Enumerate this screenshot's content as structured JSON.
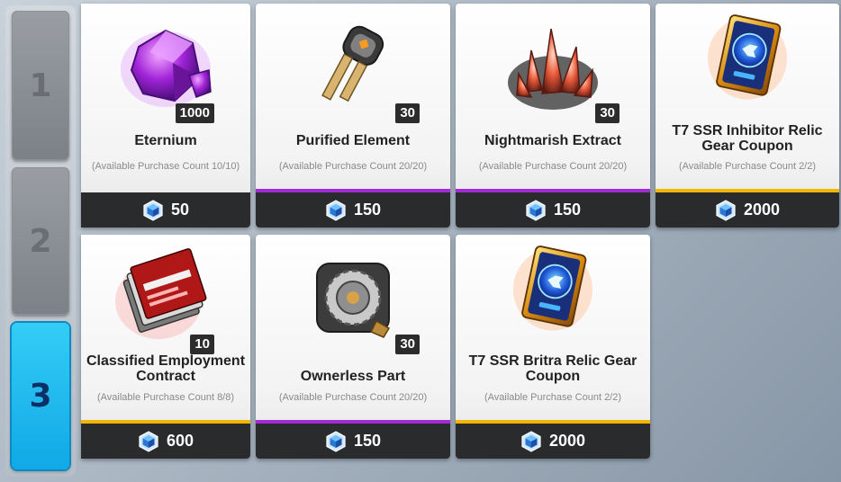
{
  "tabs": [
    {
      "label": "1",
      "active": false
    },
    {
      "label": "2",
      "active": false
    },
    {
      "label": "3",
      "active": true
    }
  ],
  "currency_icon": "gem-icon",
  "rarity_colors": {
    "purple": "#a12bd4",
    "gold": "#f2b705"
  },
  "items": [
    {
      "name": "Eternium",
      "quantity": "1000",
      "availability": "(Available Purchase Count 10/10)",
      "price": "50",
      "rarity": "none",
      "icon": "purple-crystal-icon"
    },
    {
      "name": "Purified Element",
      "quantity": "30",
      "availability": "(Available Purchase Count 20/20)",
      "price": "150",
      "rarity": "purple",
      "icon": "key-element-icon"
    },
    {
      "name": "Nightmarish Extract",
      "quantity": "30",
      "availability": "(Available Purchase Count 20/20)",
      "price": "150",
      "rarity": "purple",
      "icon": "red-crystal-cluster-icon"
    },
    {
      "name": "T7 SSR Inhibitor Relic Gear Coupon",
      "quantity": "",
      "availability": "(Available Purchase Count 2/2)",
      "price": "2000",
      "rarity": "gold",
      "icon": "gold-coupon-card-icon"
    },
    {
      "name": "Classified Employment Contract",
      "quantity": "10",
      "availability": "(Available Purchase Count 8/8)",
      "price": "600",
      "rarity": "gold",
      "icon": "contract-documents-icon"
    },
    {
      "name": "Ownerless Part",
      "quantity": "30",
      "availability": "(Available Purchase Count 20/20)",
      "price": "150",
      "rarity": "purple",
      "icon": "mechanical-gear-part-icon"
    },
    {
      "name": "T7 SSR Britra Relic Gear Coupon",
      "quantity": "",
      "availability": "(Available Purchase Count 2/2)",
      "price": "2000",
      "rarity": "gold",
      "icon": "gold-coupon-card-icon"
    }
  ]
}
